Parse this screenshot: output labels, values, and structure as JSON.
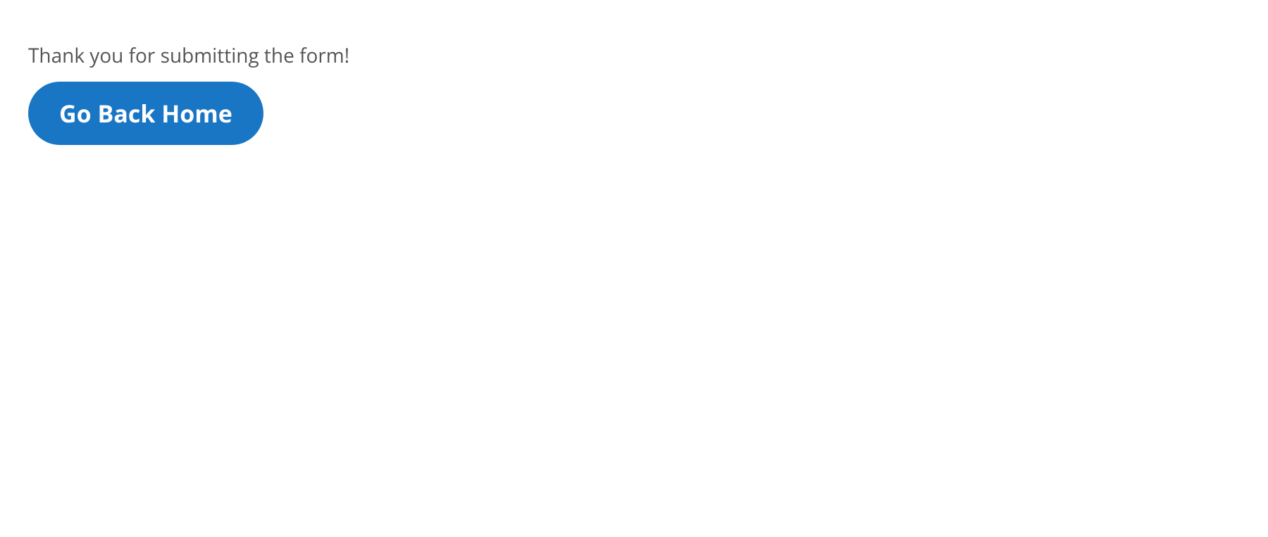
{
  "confirmation": {
    "message": "Thank you for submitting the form!",
    "home_button_label": "Go Back Home"
  }
}
